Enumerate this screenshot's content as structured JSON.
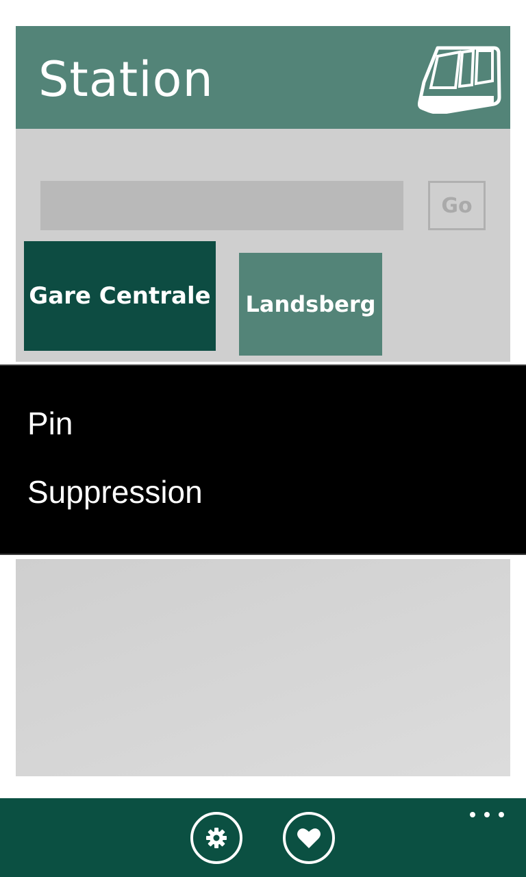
{
  "header": {
    "title": "Station",
    "icon": "tram-icon",
    "background": "#538478"
  },
  "search": {
    "value": "",
    "placeholder": "",
    "go_label": "Go"
  },
  "favorites": [
    {
      "label": "Gare Centrale",
      "color": "#0d4c42"
    },
    {
      "label": "Landsberg",
      "color": "#538478"
    }
  ],
  "context_menu": {
    "items": [
      "Pin",
      "Suppression"
    ]
  },
  "app_bar": {
    "background": "#0b5042",
    "buttons": [
      "gear-icon",
      "heart-icon"
    ],
    "more": "ellipsis-icon"
  }
}
